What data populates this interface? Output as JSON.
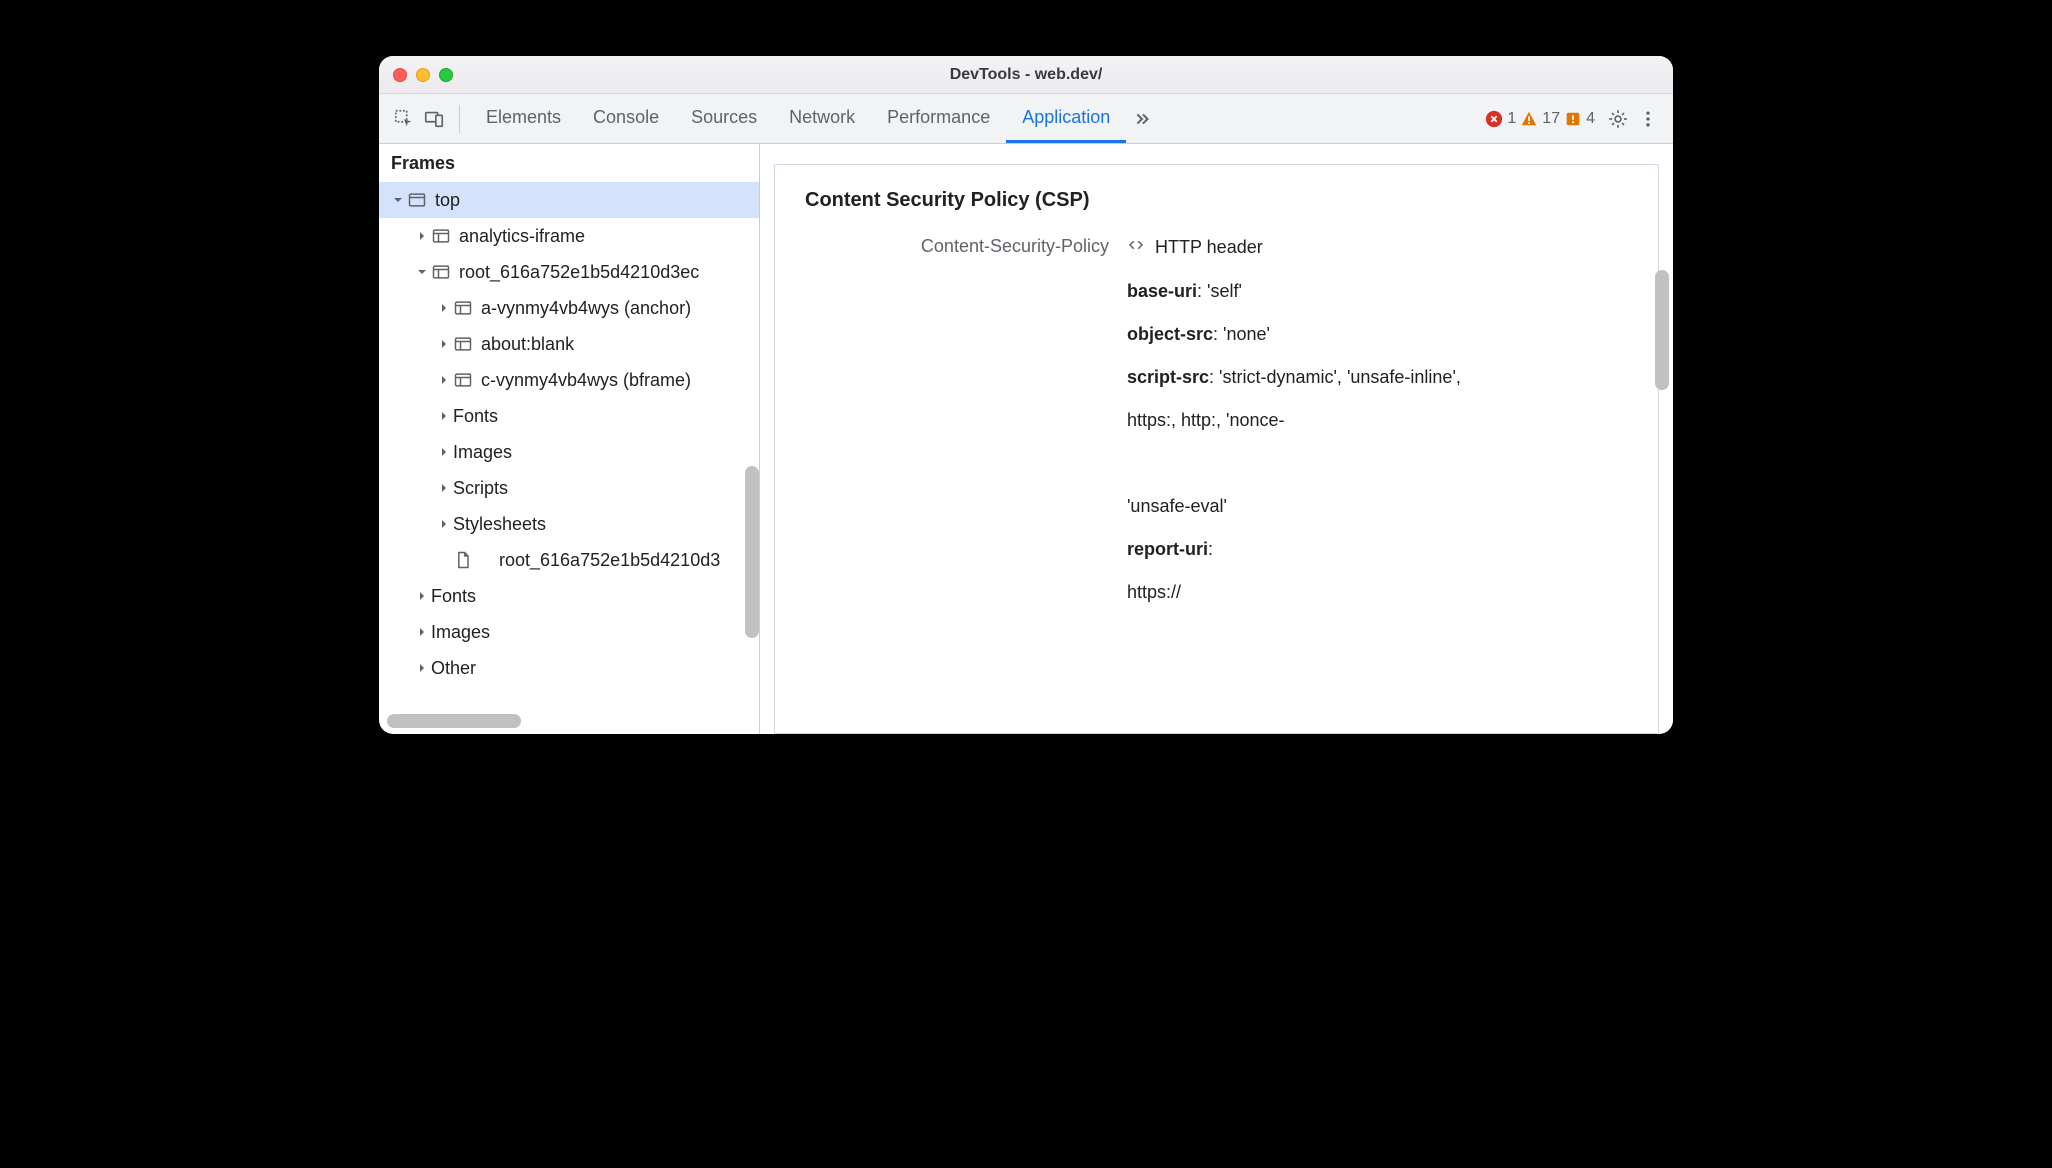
{
  "window": {
    "title": "DevTools - web.dev/"
  },
  "toolbar": {
    "tabs": [
      "Elements",
      "Console",
      "Sources",
      "Network",
      "Performance",
      "Application"
    ],
    "active_tab": "Application",
    "errors": "1",
    "warnings": "17",
    "issues": "4"
  },
  "sidebar": {
    "header": "Frames",
    "tree": [
      {
        "label": "top",
        "icon": "window",
        "expanded": true,
        "indent": 0,
        "selected": true
      },
      {
        "label": "analytics-iframe",
        "icon": "frame",
        "expanded": false,
        "indent": 1
      },
      {
        "label": "root_616a752e1b5d4210d3ec",
        "icon": "frame",
        "expanded": true,
        "indent": 1
      },
      {
        "label": "a-vynmy4vb4wys (anchor)",
        "icon": "frame",
        "expanded": false,
        "indent": 2
      },
      {
        "label": "about:blank",
        "icon": "frame",
        "expanded": false,
        "indent": 2
      },
      {
        "label": "c-vynmy4vb4wys (bframe)",
        "icon": "frame",
        "expanded": false,
        "indent": 2
      },
      {
        "label": "Fonts",
        "icon": "none",
        "expanded": false,
        "indent": 3
      },
      {
        "label": "Images",
        "icon": "none",
        "expanded": false,
        "indent": 3
      },
      {
        "label": "Scripts",
        "icon": "none",
        "expanded": false,
        "indent": 3
      },
      {
        "label": "Stylesheets",
        "icon": "none",
        "expanded": false,
        "indent": 3
      },
      {
        "label": "root_616a752e1b5d4210d3",
        "icon": "document",
        "expanded": null,
        "indent": 3
      },
      {
        "label": "Fonts",
        "icon": "none",
        "expanded": false,
        "indent": 1
      },
      {
        "label": "Images",
        "icon": "none",
        "expanded": false,
        "indent": 1
      },
      {
        "label": "Other",
        "icon": "none",
        "expanded": false,
        "indent": 1
      }
    ]
  },
  "details": {
    "section_title": "Content Security Policy (CSP)",
    "field_label": "Content-Security-Policy",
    "header_type": "HTTP header",
    "directives": [
      {
        "name": "base-uri",
        "value": "'self'"
      },
      {
        "name": "object-src",
        "value": "'none'"
      },
      {
        "name": "script-src",
        "value": "'strict-dynamic', 'unsafe-inline',"
      }
    ],
    "continuation_lines": [
      "https:, http:, 'nonce-",
      "",
      "'unsafe-eval'"
    ],
    "report_uri": {
      "name": "report-uri",
      "value": ""
    },
    "report_uri_line": "https://"
  }
}
